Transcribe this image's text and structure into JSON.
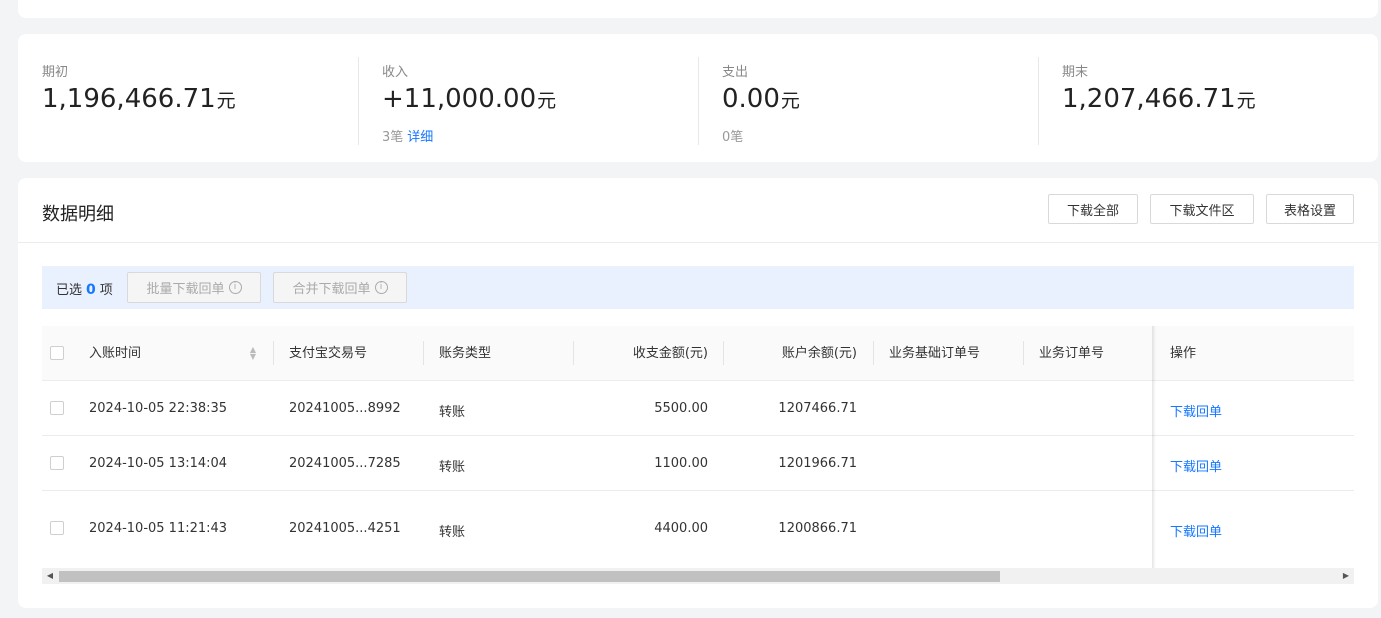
{
  "summary": {
    "opening": {
      "label": "期初",
      "amount": "1,196,466.71",
      "unit": "元"
    },
    "income": {
      "label": "收入",
      "amount": "+11,000.00",
      "unit": "元",
      "count": "3笔",
      "detail_link": "详细"
    },
    "expense": {
      "label": "支出",
      "amount": "0.00",
      "unit": "元",
      "count": "0笔"
    },
    "closing": {
      "label": "期末",
      "amount": "1,207,466.71",
      "unit": "元"
    }
  },
  "details": {
    "title": "数据明细",
    "buttons": {
      "download_all": "下载全部",
      "download_files": "下载文件区",
      "table_settings": "表格设置"
    },
    "selection": {
      "prefix": "已选",
      "count": "0",
      "suffix": "项",
      "batch_download": "批量下载回单",
      "merge_download": "合并下载回单"
    },
    "table": {
      "columns": [
        "入账时间",
        "支付宝交易号",
        "账务类型",
        "收支金额(元)",
        "账户余额(元)",
        "业务基础订单号",
        "业务订单号",
        "操作"
      ],
      "rows": [
        {
          "time": "2024-10-05 22:38:35",
          "trade_no": "20241005...8992",
          "type": "转账",
          "amount": "5500.00",
          "balance": "1207466.71",
          "base_order": "",
          "order": "",
          "action": "下载回单"
        },
        {
          "time": "2024-10-05 13:14:04",
          "trade_no": "20241005...7285",
          "type": "转账",
          "amount": "1100.00",
          "balance": "1201966.71",
          "base_order": "",
          "order": "",
          "action": "下载回单"
        },
        {
          "time": "2024-10-05 11:21:43",
          "trade_no": "20241005...4251",
          "type": "转账",
          "amount": "4400.00",
          "balance": "1200866.71",
          "base_order": "",
          "order": "",
          "action": "下载回单"
        }
      ]
    }
  },
  "icons": {
    "info": "info-circle-icon",
    "sort": "sort-icon",
    "scroll_left": "chevron-left-icon",
    "scroll_right": "chevron-right-icon"
  },
  "colors": {
    "link": "#1677ff",
    "selection_bg": "#e9f1fe",
    "page_bg": "#f3f4f6"
  }
}
